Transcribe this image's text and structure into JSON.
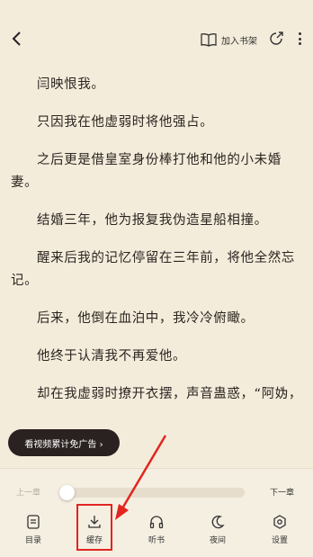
{
  "header": {
    "add_bookshelf_label": "加入书架"
  },
  "paragraphs": [
    "闫映恨我。",
    "只因我在他虚弱时将他强占。",
    "之后更是借皇室身份棒打他和他的小未婚妻。",
    "结婚三年，他为报复我伪造星船相撞。",
    "醒来后我的记忆停留在三年前，将他全然忘记。",
    "后来，他倒在血泊中，我冷冷俯瞰。",
    "他终于认清我不再爱他。",
    "却在我虚弱时撩开衣摆，声音蛊惑，“阿妫，"
  ],
  "ad": {
    "label": "看视频累计免广告 ›"
  },
  "reader_controls": {
    "prev_chapter": "上一章",
    "next_chapter": "下一章",
    "progress": 0.0
  },
  "nav": [
    {
      "id": "catalog",
      "label": "目录",
      "icon": "catalog-icon"
    },
    {
      "id": "cache",
      "label": "缓存",
      "icon": "download-icon"
    },
    {
      "id": "listen",
      "label": "听书",
      "icon": "headphones-icon"
    },
    {
      "id": "night",
      "label": "夜间",
      "icon": "moon-icon"
    },
    {
      "id": "settings",
      "label": "设置",
      "icon": "settings-icon"
    }
  ],
  "colors": {
    "background": "#f4ecdb",
    "highlight": "#e2251f",
    "ad_pill": "#2a2220"
  }
}
